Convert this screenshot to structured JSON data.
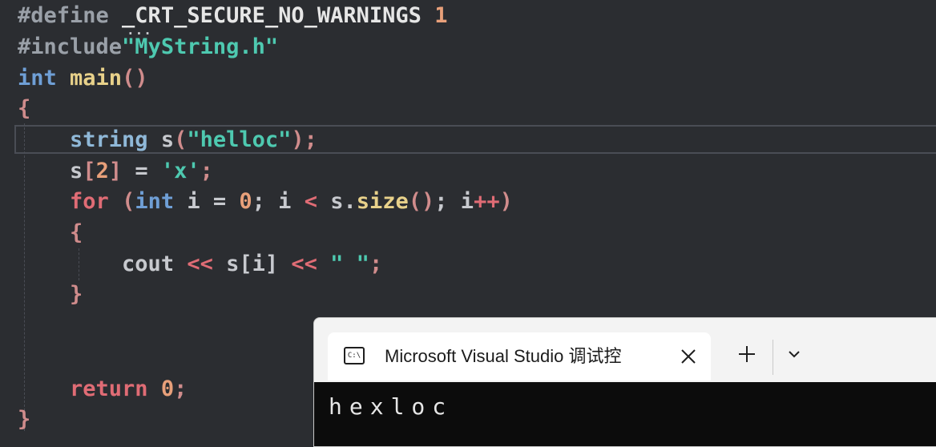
{
  "editor": {
    "lines": {
      "l1": {
        "pp": "#define ",
        "macro": "_CRT_SECURE_NO_WARNINGS ",
        "num": "1"
      },
      "l2": {
        "pp": "#include",
        "str": "\"MyString.h\""
      },
      "l3": {
        "kw": "int ",
        "fn": "main",
        "paren": "()"
      },
      "l4": {
        "brace": "{"
      },
      "l5": {
        "indent": "    ",
        "typ": "string",
        "var": " s",
        "p1": "(",
        "str": "\"helloc\"",
        "p2": ");"
      },
      "l6": {
        "indent": "    ",
        "var": "s",
        "b1": "[",
        "num": "2",
        "b2": "]",
        "op": " = ",
        "str": "'x'",
        "semi": ";"
      },
      "l7": {
        "indent": "    ",
        "ctl": "for",
        "p1": " (",
        "kw": "int",
        "v1": " i ",
        "op1": "=",
        "num": " 0",
        "s1": "; i ",
        "op2": "<",
        "v2": " s.",
        "fn": "size",
        "p2": "()",
        "s2": "; i",
        "op3": "++",
        "p3": ")"
      },
      "l8": {
        "indent": "    ",
        "brace": "{"
      },
      "l9": {
        "indent": "        ",
        "var": "cout ",
        "op1": "<<",
        "v2": " s[i] ",
        "op2": "<<",
        "str": " \" \"",
        "semi": ";"
      },
      "l10": {
        "indent": "    ",
        "brace": "}"
      },
      "l11": {
        "indent": "    ",
        "ctl": "return",
        "num": " 0",
        "semi": ";"
      },
      "l12": {
        "brace": "}"
      }
    }
  },
  "terminal": {
    "tab_title": "Microsoft Visual Studio 调试控",
    "tab_icon_text": "C:\\",
    "new_tab_symbol": "+",
    "output_line": "hexloc"
  },
  "colors": {
    "editor_bg": "#2b2d31",
    "keyword": "#6f9fd6",
    "control": "#e06c75",
    "string": "#4ec9b0",
    "number": "#e8a07a",
    "function": "#e8d18a",
    "console_bg": "#0c0c0c"
  }
}
